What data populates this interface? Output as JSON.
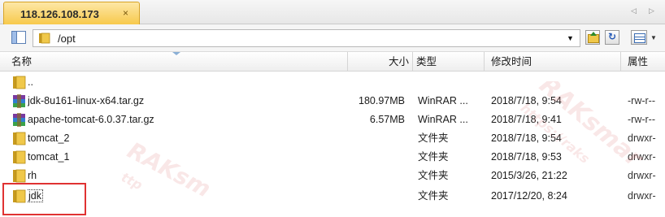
{
  "tab": {
    "title": "118.126.108.173",
    "close": "×"
  },
  "tab_nav": {
    "prev": "◁",
    "next": "▷"
  },
  "path": {
    "value": "/opt",
    "dropdown": "▼"
  },
  "toolbar": {
    "refresh": "↻",
    "view_menu": "▼"
  },
  "columns": {
    "name": "名称",
    "size": "大小",
    "type": "类型",
    "mtime": "修改时间",
    "attr": "属性"
  },
  "files": [
    {
      "icon": "folder-up-icon",
      "name": "..",
      "size": "",
      "type": "",
      "mtime": "",
      "attr": ""
    },
    {
      "icon": "archive-icon",
      "name": "jdk-8u161-linux-x64.tar.gz",
      "size": "180.97MB",
      "type": "WinRAR ...",
      "mtime": "2018/7/18, 9:54",
      "attr": "-rw-r--"
    },
    {
      "icon": "archive-icon",
      "name": "apache-tomcat-6.0.37.tar.gz",
      "size": "6.57MB",
      "type": "WinRAR ...",
      "mtime": "2018/7/18, 9:41",
      "attr": "-rw-r--"
    },
    {
      "icon": "folder-icon",
      "name": "tomcat_2",
      "size": "",
      "type": "文件夹",
      "mtime": "2018/7/18, 9:54",
      "attr": "drwxr-"
    },
    {
      "icon": "folder-icon",
      "name": "tomcat_1",
      "size": "",
      "type": "文件夹",
      "mtime": "2018/7/18, 9:53",
      "attr": "drwxr-"
    },
    {
      "icon": "folder-icon",
      "name": "rh",
      "size": "",
      "type": "文件夹",
      "mtime": "2015/3/26, 21:22",
      "attr": "drwxr-"
    },
    {
      "icon": "folder-icon",
      "name": "jdk",
      "size": "",
      "type": "文件夹",
      "mtime": "2017/12/20, 8:24",
      "attr": "drwxr-"
    }
  ],
  "colors": {
    "tab_accent": "#f7c94c",
    "highlight_box": "#e03232",
    "folder": "#f0c84a"
  }
}
